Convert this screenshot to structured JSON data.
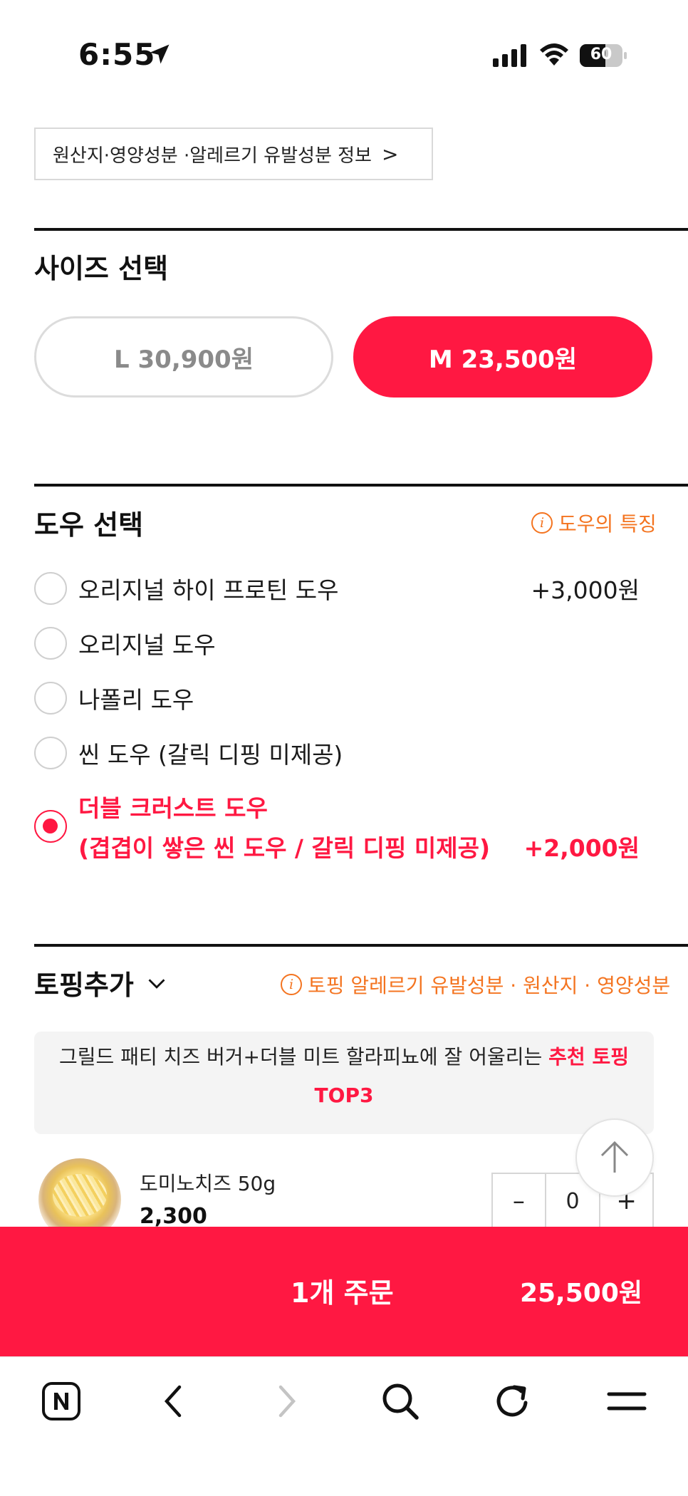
{
  "status_bar": {
    "time": "6:55",
    "battery": "60",
    "battery_level": 0.6
  },
  "info_button": {
    "label": "원산지·영양성분 ·알레르기 유발성분 정보",
    "chevron": ">"
  },
  "size_section": {
    "title": "사이즈 선택",
    "options": [
      {
        "label": "L 30,900원",
        "selected": false
      },
      {
        "label": "M 23,500원",
        "selected": true
      }
    ]
  },
  "dough_section": {
    "title": "도우 선택",
    "feature_link": "도우의 특징",
    "options": [
      {
        "label": "오리지널 하이 프로틴 도우",
        "price": "+3,000원",
        "selected": false
      },
      {
        "label": "오리지널 도우",
        "price": "",
        "selected": false
      },
      {
        "label": "나폴리 도우",
        "price": "",
        "selected": false
      },
      {
        "label": "씬 도우 (갈릭 디핑 미제공)",
        "price": "",
        "selected": false
      },
      {
        "label": "더블 크러스트 도우",
        "label2": "(겹겹이 쌓은 씬 도우 / 갈릭 디핑 미제공)",
        "price": "+2,000원",
        "selected": true
      }
    ]
  },
  "topping_section": {
    "title": "토핑추가",
    "info_link": "토핑 알레르기 유발성분 · 원산지 · 영양성분",
    "reco_text": "그릴드 패티 치즈 버거+더블 미트 할라피뇨에 잘 어울리는",
    "reco_highlight": "추천 토핑",
    "reco_highlight2": "TOP3",
    "items": [
      {
        "name": "도미노치즈 50g",
        "price": "2,300",
        "qty": "0",
        "minus": "–",
        "plus": "+"
      }
    ]
  },
  "order_bar": {
    "label": "1개 주문",
    "total": "25,500원"
  },
  "colors": {
    "accent": "#ff1842",
    "link": "#f47420"
  },
  "browser_nav": {
    "icons": [
      "naver-icon",
      "back-icon",
      "forward-icon",
      "search-icon",
      "reload-icon",
      "menu-icon"
    ]
  }
}
